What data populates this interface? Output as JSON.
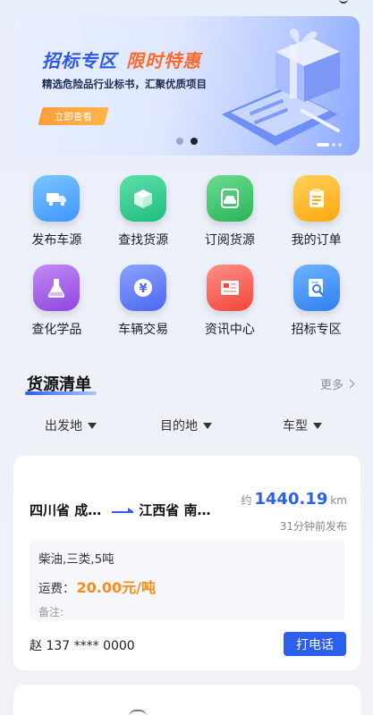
{
  "banner": {
    "title_part1": "招标专区",
    "title_part2": "限时特惠",
    "subtitle": "精选危险品行业标书，汇聚优质项目",
    "button": "立即查看"
  },
  "grid": [
    {
      "label": "发布车源",
      "icon": "truck-icon",
      "color": "#4aa6ff"
    },
    {
      "label": "查找货源",
      "icon": "cube-icon",
      "color": "#2ec98a"
    },
    {
      "label": "订阅货源",
      "icon": "car-icon",
      "color": "#36c267"
    },
    {
      "label": "我的订单",
      "icon": "clipboard-icon",
      "color": "#ffb319"
    },
    {
      "label": "查化学品",
      "icon": "flask-icon",
      "color": "#a35ee8"
    },
    {
      "label": "车辆交易",
      "icon": "yen-icon",
      "color": "#5f7cf5"
    },
    {
      "label": "资讯中心",
      "icon": "news-icon",
      "color": "#ff5e52"
    },
    {
      "label": "招标专区",
      "icon": "tender-search-icon",
      "color": "#3d8ff5"
    }
  ],
  "section": {
    "title": "货源清单",
    "more": "更多"
  },
  "filters": {
    "origin": "出发地",
    "destination": "目的地",
    "vehicle": "车型"
  },
  "cargo": {
    "from": "四川省 成…",
    "to": "江西省 南…",
    "distance_prefix": "约",
    "distance": "1440.19",
    "distance_unit": "km",
    "published": "31分钟前发布",
    "goods": "柴油,三类,5吨",
    "fee_label": "运费：",
    "fee_value": "20.00元/吨",
    "note": "备注:",
    "contact": "赵 137 **** 0000",
    "call_button": "打电话"
  }
}
